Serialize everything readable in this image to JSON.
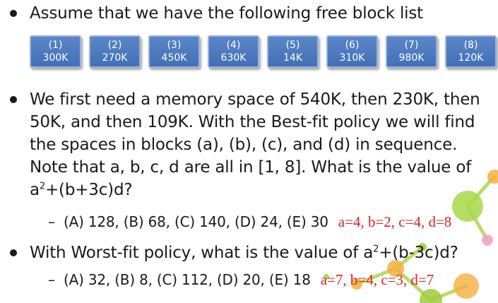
{
  "bullet1": {
    "text": "Assume that we have the following free block list"
  },
  "blocks": [
    {
      "num": "(1)",
      "size": "300K"
    },
    {
      "num": "(2)",
      "size": "270K"
    },
    {
      "num": "(3)",
      "size": "450K"
    },
    {
      "num": "(4)",
      "size": "630K"
    },
    {
      "num": "(5)",
      "size": "14K"
    },
    {
      "num": "(6)",
      "size": "310K"
    },
    {
      "num": "(7)",
      "size": "980K"
    },
    {
      "num": "(8)",
      "size": "120K"
    }
  ],
  "bullet2": {
    "text_before_sup": "We first need a memory space of 540K, then 230K, then 50K, and then 109K. With the Best-fit policy we will find the spaces in blocks (a), (b), (c), and (d) in sequence. Note that a, b, c, d are all in [1, 8]. What is the value of a",
    "sup": "2",
    "text_after_sup": "+(b+3c)d?"
  },
  "sub1": {
    "dash": "–",
    "options": "(A) 128, (B) 68, (C) 140, (D) 24, (E) 30",
    "answer": "a=4, b=2, c=4, d=8"
  },
  "bullet3": {
    "text_before_sup": "With Worst-fit policy, what is the value of a",
    "sup": "2",
    "text_after_sup": "+(b-3c)d?"
  },
  "sub2": {
    "dash": "–",
    "options": "(A) 32, (B) 8, (C) 112, (D) 20, (E) 18",
    "answer": "a=7, b=4, c=3, d=7"
  },
  "colors": {
    "block_fill": "#4a78bf",
    "answer_red": "#e02020",
    "deco_green": "#9ccc3c",
    "deco_orange": "#f5b040",
    "deco_pink": "#f0a0c8"
  }
}
